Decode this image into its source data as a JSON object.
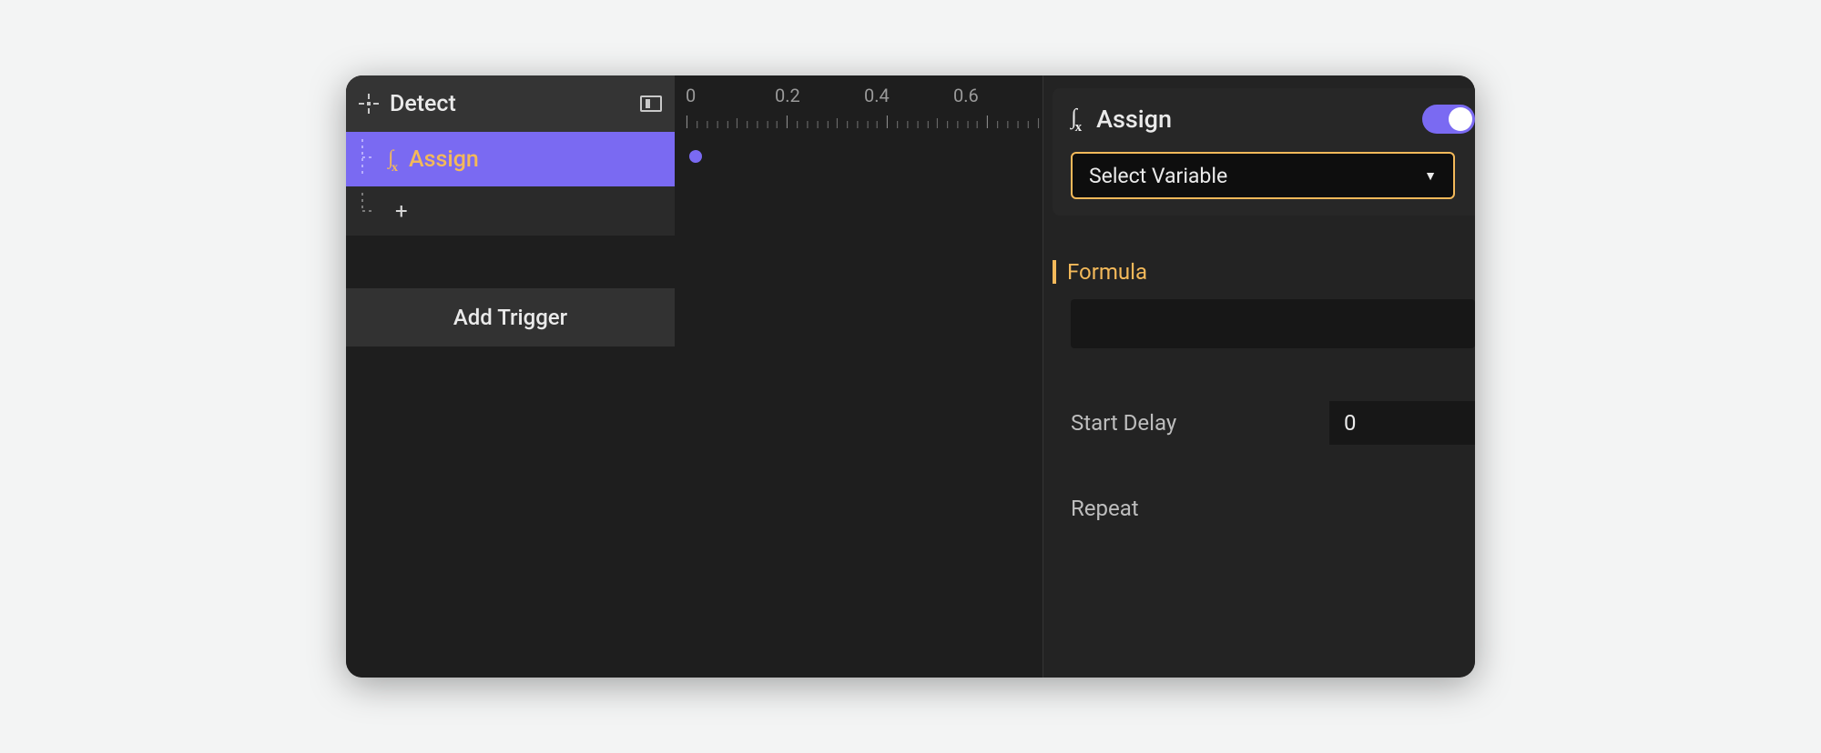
{
  "left": {
    "trigger_title": "Detect",
    "assign_label": "Assign",
    "add_trigger_label": "Add Trigger"
  },
  "timeline": {
    "ticks": [
      "0",
      "0.2",
      "0.4",
      "0.6"
    ]
  },
  "inspector": {
    "title": "Assign",
    "select_placeholder": "Select Variable",
    "formula_label": "Formula",
    "formula_value": "",
    "start_delay_label": "Start Delay",
    "start_delay_value": "0",
    "repeat_label": "Repeat"
  },
  "colors": {
    "accent_purple": "#7a6af2",
    "accent_orange": "#f3b95a"
  }
}
